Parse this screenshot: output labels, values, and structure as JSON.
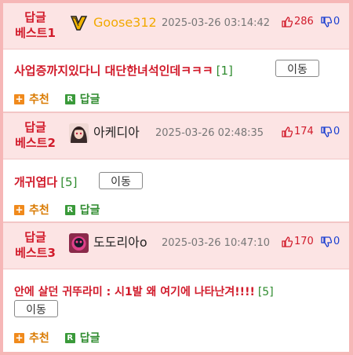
{
  "comments": [
    {
      "badge_line1": "답글",
      "badge_line2": "베스트1",
      "nickname": "Goose312",
      "nickname_color": "#f2a900",
      "timestamp": "2025-03-26 03:14:42",
      "upvotes": "286",
      "downvotes": "0",
      "text": "사업증까지있다니 대단한녀석인데ㅋㅋㅋ",
      "reply_count": "[1]",
      "move_label": "이동",
      "recommend_label": "추천",
      "reply_label": "답글"
    },
    {
      "badge_line1": "답글",
      "badge_line2": "베스트2",
      "nickname": "아케디아",
      "nickname_color": "#222222",
      "timestamp": "2025-03-26 02:48:35",
      "upvotes": "174",
      "downvotes": "0",
      "text": "개귀엽다",
      "reply_count": "[5]",
      "move_label": "이동",
      "recommend_label": "추천",
      "reply_label": "답글"
    },
    {
      "badge_line1": "답글",
      "badge_line2": "베스트3",
      "nickname": "도도리아o",
      "nickname_color": "#222222",
      "timestamp": "2025-03-26 10:47:10",
      "upvotes": "170",
      "downvotes": "0",
      "text": "안에 살던 귀뚜라미 : 시1발 왜 여기에 나타난겨!!!!",
      "reply_count": "[5]",
      "move_label": "이동",
      "recommend_label": "추천",
      "reply_label": "답글"
    }
  ],
  "icons": {
    "thumbs_up": "thumbs-up-icon",
    "thumbs_down": "thumbs-down-icon",
    "recommend": "plus-icon",
    "reply": "reply-r-icon"
  },
  "colors": {
    "accent_red": "#d11a2a",
    "header_bg": "#fce4e4",
    "frame_bg": "#f6b7b7",
    "reply_green": "#2e8b2e",
    "recommend_orange": "#f08a1c"
  }
}
